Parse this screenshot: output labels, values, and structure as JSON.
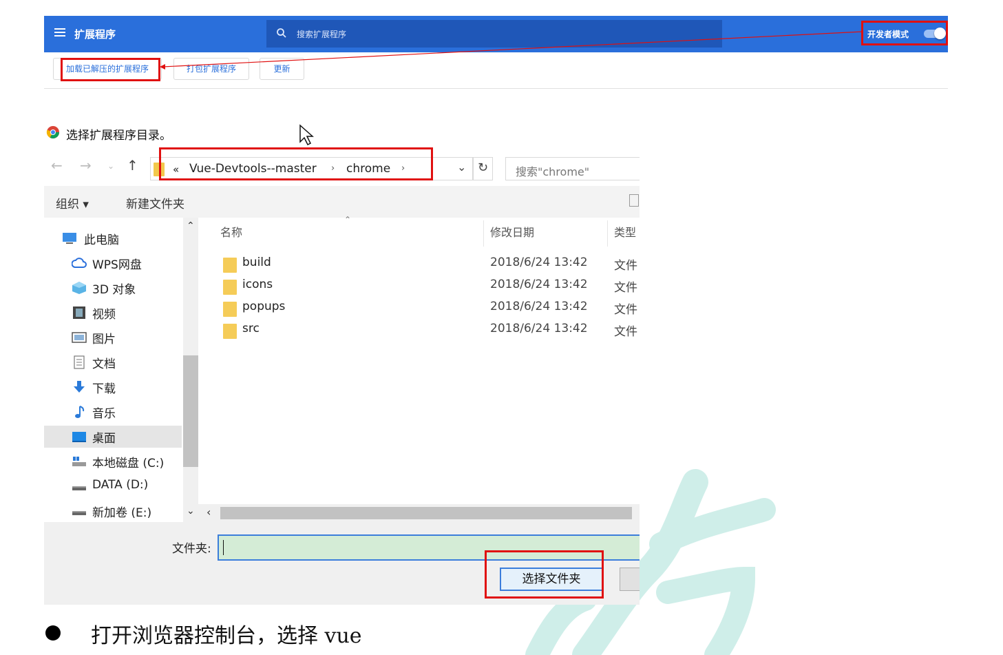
{
  "extensions": {
    "title": "扩展程序",
    "search_placeholder": "搜索扩展程序",
    "dev_mode_label": "开发者模式",
    "dev_mode_on": true,
    "buttons": {
      "load_unpacked": "加载已解压的扩展程序",
      "pack": "打包扩展程序",
      "update": "更新"
    }
  },
  "dialog": {
    "title": "选择扩展程序目录。",
    "breadcrumb": {
      "prefix": "«",
      "parts": [
        "Vue-Devtools--master",
        "chrome"
      ],
      "sep": "›"
    },
    "search_placeholder": "搜索\"chrome\"",
    "commands": {
      "organize": "组织 ▾",
      "new_folder": "新建文件夹"
    },
    "nav": [
      {
        "label": "此电脑",
        "icon": "computer-icon"
      },
      {
        "label": "WPS网盘",
        "icon": "cloud-icon"
      },
      {
        "label": "3D 对象",
        "icon": "cube-icon"
      },
      {
        "label": "视频",
        "icon": "video-icon"
      },
      {
        "label": "图片",
        "icon": "picture-icon"
      },
      {
        "label": "文档",
        "icon": "document-icon"
      },
      {
        "label": "下载",
        "icon": "download-icon"
      },
      {
        "label": "音乐",
        "icon": "music-icon"
      },
      {
        "label": "桌面",
        "icon": "desktop-icon",
        "selected": true
      },
      {
        "label": "本地磁盘 (C:)",
        "icon": "disk-icon"
      },
      {
        "label": "DATA (D:)",
        "icon": "drive-icon"
      },
      {
        "label": "新加卷 (E:)",
        "icon": "drive-icon"
      }
    ],
    "columns": {
      "name": "名称",
      "date": "修改日期",
      "type": "类型"
    },
    "rows": [
      {
        "name": "build",
        "date": "2018/6/24 13:42",
        "type": "文件"
      },
      {
        "name": "icons",
        "date": "2018/6/24 13:42",
        "type": "文件"
      },
      {
        "name": "popups",
        "date": "2018/6/24 13:42",
        "type": "文件"
      },
      {
        "name": "src",
        "date": "2018/6/24 13:42",
        "type": "文件"
      }
    ],
    "folder_label": "文件夹:",
    "folder_value": "",
    "select_button": "选择文件夹"
  },
  "document_text": {
    "bullet_line": "打开浏览器控制台，选择 vue"
  },
  "colors": {
    "chrome_blue": "#2a6fdb",
    "highlight_red": "#e01010",
    "folder_yellow": "#f5cc58"
  }
}
